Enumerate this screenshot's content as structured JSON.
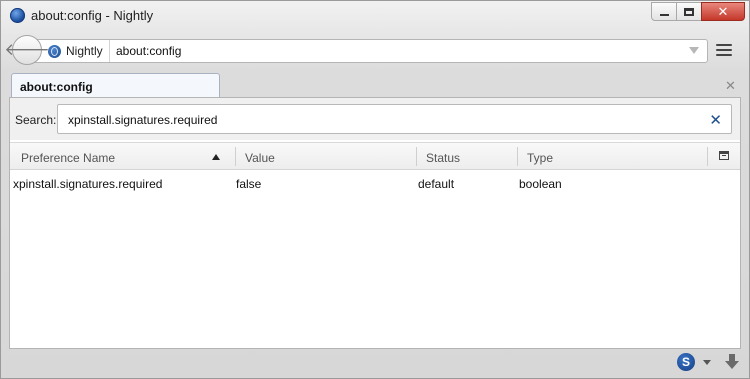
{
  "window": {
    "title": "about:config - Nightly",
    "close_label": "✕"
  },
  "navbar": {
    "back_label": "🡐",
    "identity_label": "Nightly",
    "url": "about:config"
  },
  "tabs": [
    {
      "label": "about:config"
    }
  ],
  "tab_close_label": "✕",
  "search": {
    "label": "Search:",
    "value": "xpinstall.signatures.required",
    "clear_label": "✕"
  },
  "columns": [
    {
      "label": "Preference Name"
    },
    {
      "label": "Value"
    },
    {
      "label": "Status"
    },
    {
      "label": "Type"
    }
  ],
  "rows": [
    {
      "name": "xpinstall.signatures.required",
      "value": "false",
      "status": "default",
      "type": "boolean"
    }
  ],
  "statusbar": {
    "addon_icon_label": "S"
  },
  "icons": {
    "app": "firefox-nightly-logo",
    "back": "back-arrow-icon",
    "identity": "globe-icon",
    "url_dropdown": "dropdown-triangle-icon",
    "menu": "hamburger-menu-icon",
    "search_clear": "close-icon",
    "sort": "sort-ascending-icon",
    "column_picker": "column-picker-icon",
    "download": "download-arrow-icon"
  },
  "colors": {
    "accent": "#1d4f8f",
    "close_button": "#c4382b"
  }
}
